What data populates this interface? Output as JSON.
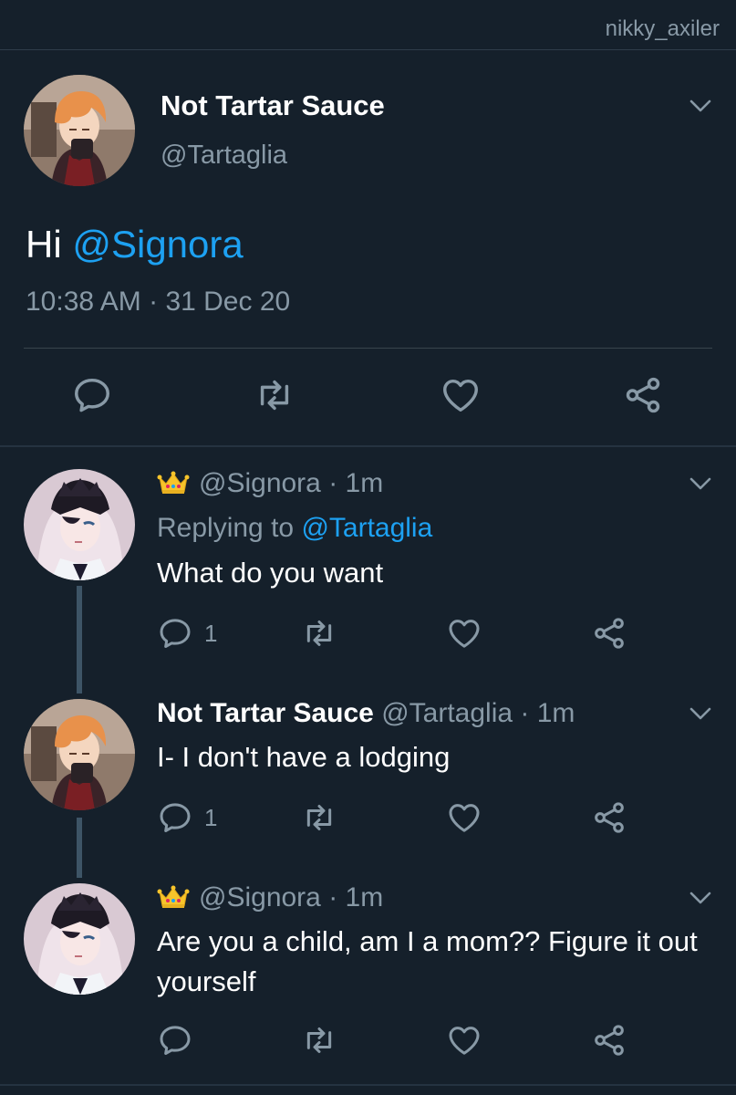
{
  "watermark": "nikky_axiler",
  "main_tweet": {
    "display_name": "Not Tartar Sauce",
    "handle": "@Tartaglia",
    "text_prefix": "Hi ",
    "mention": "@Signora",
    "time": "10:38 AM",
    "separator": " · ",
    "date": "31 Dec 20",
    "avatar": "tartaglia-avatar"
  },
  "replies": [
    {
      "handle": "@Signora",
      "time": "· 1m",
      "replying_label": "Replying to ",
      "replying_mention": "@Tartaglia",
      "text": "What do you want",
      "reply_count": "1",
      "avatar": "signora-avatar",
      "badge": "crown-emoji"
    },
    {
      "display_name": "Not Tartar Sauce",
      "handle": "@Tartaglia",
      "time": "· 1m",
      "text": "I- I don't have a lodging",
      "reply_count": "1",
      "avatar": "tartaglia-avatar"
    },
    {
      "handle": "@Signora",
      "time": "· 1m",
      "text": "Are you a child, am I a mom?? Figure it out yourself",
      "avatar": "signora-avatar",
      "badge": "crown-emoji"
    }
  ],
  "icons": [
    "reply-icon",
    "retweet-icon",
    "like-icon",
    "share-icon",
    "chevron-down-icon"
  ],
  "colors": {
    "background": "#15202b",
    "secondary_text": "#8899a6",
    "link": "#1da1f2",
    "divider": "#38444d"
  }
}
